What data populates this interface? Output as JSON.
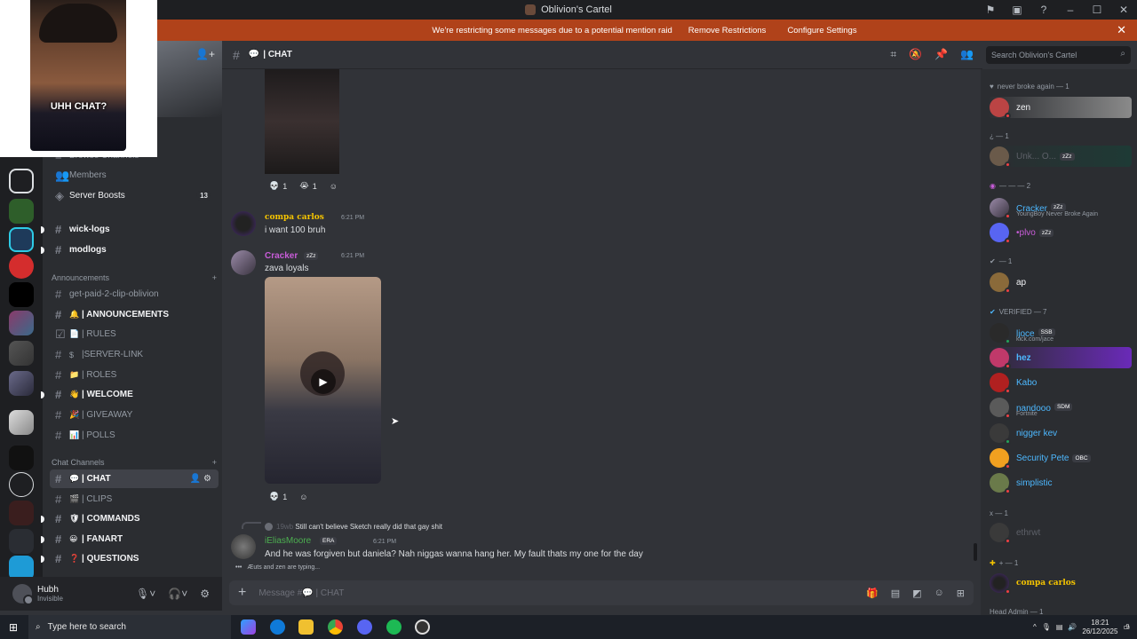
{
  "window": {
    "title": "Oblivion's Cartel"
  },
  "banner": {
    "message": "We're restricting some messages due to a potential mention raid",
    "remove_label": "Remove Restrictions",
    "configure_label": "Configure Settings"
  },
  "webcam": {
    "overlay_text": "UHH CHAT?"
  },
  "sidebar": {
    "top_items": [
      {
        "label": "Browse Channels"
      },
      {
        "label": "Members"
      },
      {
        "label": "Server Boosts",
        "badge": "13"
      }
    ],
    "channels_a": [
      {
        "label": "wick-logs"
      },
      {
        "label": "modlogs"
      }
    ],
    "announcements_label": "Announcements",
    "announcement_channels": [
      {
        "label": "get-paid-2-clip-oblivion",
        "emoji": ""
      },
      {
        "label": "| ANNOUNCEMENTS",
        "emoji": "🔔"
      },
      {
        "label": "| RULES",
        "emoji": "📄"
      },
      {
        "label": "|SERVER-LINK",
        "emoji": "$"
      },
      {
        "label": "| ROLES",
        "emoji": "📁"
      },
      {
        "label": "| WELCOME",
        "emoji": "👋"
      },
      {
        "label": "| GIVEAWAY",
        "emoji": "🎉"
      },
      {
        "label": "| POLLS",
        "emoji": "📊"
      }
    ],
    "chat_channels_label": "Chat Channels",
    "chat_channels": [
      {
        "label": "| CHAT",
        "emoji": "💬"
      },
      {
        "label": "| CLIPS",
        "emoji": "🎬"
      },
      {
        "label": "| COMMANDS",
        "emoji": "🛡"
      },
      {
        "label": "| FANART",
        "emoji": "😀"
      },
      {
        "label": "| QUESTIONS",
        "emoji": "❓"
      }
    ]
  },
  "user_panel": {
    "name": "Hubh",
    "status": "Invisible"
  },
  "header": {
    "channel_name": "| CHAT",
    "search_placeholder": "Search Oblivion's Cartel"
  },
  "messages": {
    "reactions_1": [
      {
        "emoji": "💀",
        "count": "1"
      },
      {
        "emoji": "😭",
        "count": "1"
      }
    ],
    "m1": {
      "author": "compa carlos",
      "time": "6:21 PM",
      "text": "i want 100 bruh"
    },
    "m2": {
      "author": "Cracker",
      "tag": "zZz",
      "time": "6:21 PM",
      "text": "zava loyals"
    },
    "reactions_2": [
      {
        "emoji": "💀",
        "count": "1"
      }
    ],
    "reply": {
      "ref_author": "19wb",
      "ref_text": "Still can't believe Sketch really did that gay shit"
    },
    "m3": {
      "author": "iEliasMoore",
      "tag": "ERA",
      "time": "6:21 PM",
      "text": "And he was forgiven but daniela? Nah niggas wanna hang her. My fault thats my one for the day"
    },
    "typing": {
      "users": "Æuts and zen are typing..."
    }
  },
  "composer": {
    "placeholder": "Message #💬 | CHAT"
  },
  "members": {
    "groups": [
      {
        "label": "never broke again — 1"
      },
      {
        "label": "¿ — 1"
      },
      {
        "label": "— — — 2"
      },
      {
        "label": "— 1"
      },
      {
        "label": "VERIFIED — 7"
      },
      {
        "label": "x — 1"
      },
      {
        "label": "+ — 1"
      },
      {
        "label": "Head Admin — 1"
      }
    ],
    "list": [
      {
        "name": "zen",
        "color": "#f2f3f5"
      },
      {
        "name": "Unk... O...",
        "color": "#5d6068",
        "tag": "zZz"
      },
      {
        "name": "Cracker",
        "color": "#4db8ff",
        "tag": "zZz",
        "sub": "YoungBoy Never Broke Again"
      },
      {
        "name": "•plvo",
        "color": "#c85cd8",
        "tag": "zZz"
      },
      {
        "name": "ap",
        "color": "#f2f3f5"
      },
      {
        "name": "ljoce",
        "color": "#4db8ff",
        "tag": "SSB",
        "sub": "kick.com/jace"
      },
      {
        "name": "hez",
        "color": "#4db8ff"
      },
      {
        "name": "Kabo",
        "color": "#4db8ff"
      },
      {
        "name": "nandooo",
        "color": "#4db8ff",
        "tag": "SDM",
        "sub": "Fortnite"
      },
      {
        "name": "nigger kev",
        "color": "#4db8ff"
      },
      {
        "name": "Security Pete",
        "color": "#4db8ff",
        "tag": "OBC"
      },
      {
        "name": "simplistic",
        "color": "#4db8ff"
      },
      {
        "name": "ethrwt",
        "color": "#5d6068"
      },
      {
        "name": "compa carlos",
        "color": "#f5c400"
      }
    ]
  },
  "taskbar": {
    "search_placeholder": "Type here to search",
    "time": "18:21",
    "date": "26/12/2025",
    "notif_count": "9"
  },
  "colors": {
    "banner": "#b0421a",
    "accent": "#5865f2"
  }
}
